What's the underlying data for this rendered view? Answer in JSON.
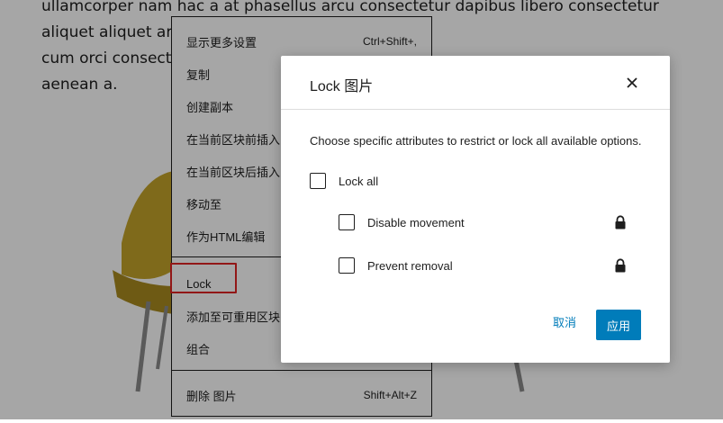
{
  "content": {
    "lines": [
      "ullamcorper nam hac a at phasellus arcu consectetur dapibus libero consectetur",
      "aliquet aliquet arcu                                    maecenas mauris tellus",
      "cum orci consecte",
      "aenean a."
    ]
  },
  "menu": {
    "items": [
      {
        "label": "显示更多设置",
        "shortcut": "Ctrl+Shift+,"
      },
      {
        "label": "复制",
        "shortcut": ""
      },
      {
        "label": "创建副本",
        "shortcut": ""
      },
      {
        "label": "在当前区块前插入",
        "shortcut": ""
      },
      {
        "label": "在当前区块后插入",
        "shortcut": ""
      },
      {
        "label": "移动至",
        "shortcut": ""
      },
      {
        "label": "作为HTML编辑",
        "shortcut": ""
      },
      {
        "label": "Lock",
        "shortcut": ""
      },
      {
        "label": "添加至可重用区块",
        "shortcut": ""
      },
      {
        "label": "组合",
        "shortcut": ""
      },
      {
        "label": "删除 图片",
        "shortcut": "Shift+Alt+Z"
      }
    ]
  },
  "modal": {
    "title": "Lock 图片",
    "description": "Choose specific attributes to restrict or lock all available options.",
    "lock_all_label": "Lock all",
    "options": [
      {
        "label": "Disable movement",
        "icon": "lock-icon"
      },
      {
        "label": "Prevent removal",
        "icon": "lock-icon"
      }
    ],
    "cancel_label": "取消",
    "apply_label": "应用",
    "close_icon": "close-icon"
  },
  "colors": {
    "accent": "#007cba",
    "highlight": "#e02424",
    "chair": "#c4a32a"
  }
}
